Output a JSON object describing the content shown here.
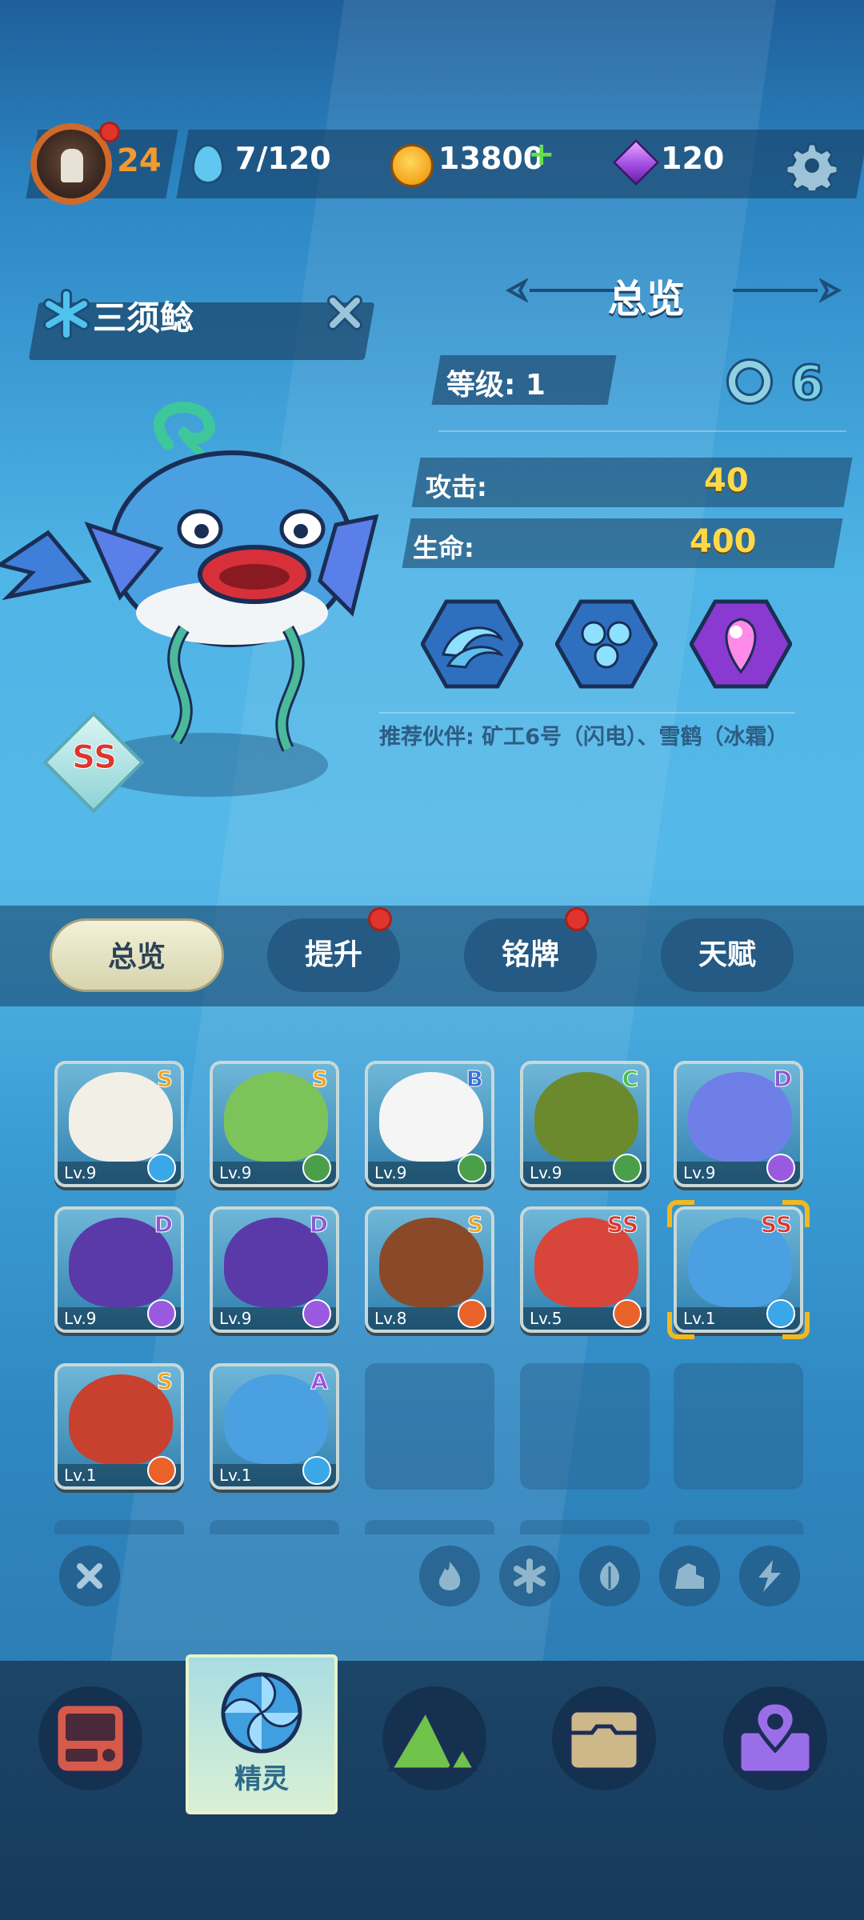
{
  "topbar": {
    "player_level": "24",
    "energy": "7/120",
    "coins": "13800",
    "plus_label": "+",
    "gems": "120"
  },
  "pet": {
    "name": "三须鲶",
    "rank": "SS"
  },
  "overview": {
    "title": "总览",
    "level_label": "等级: 1",
    "level_icon_text": "6",
    "attack_label": "攻击:",
    "attack_value": "40",
    "hp_label": "生命:",
    "hp_value": "400",
    "recommend_text": "推荐伙伴: 矿工6号（闪电）、雪鹤（冰霜）"
  },
  "tabs": [
    {
      "label": "总览",
      "active": true
    },
    {
      "label": "提升",
      "active": false
    },
    {
      "label": "铭牌",
      "active": false
    },
    {
      "label": "天赋",
      "active": false
    }
  ],
  "pets_grid": [
    {
      "grade": "S",
      "level": "Lv.9",
      "element": "snowflake",
      "grade_color": "#f3a21e",
      "body": "#f2efe6"
    },
    {
      "grade": "S",
      "level": "Lv.9",
      "element": "leaf",
      "grade_color": "#f3a21e",
      "body": "#7cc35a"
    },
    {
      "grade": "B",
      "level": "Lv.9",
      "element": "leaf",
      "grade_color": "#3c6ed8",
      "body": "#f5f5f5"
    },
    {
      "grade": "C",
      "level": "Lv.9",
      "element": "leaf",
      "grade_color": "#4bbf4b",
      "body": "#6b8a2e"
    },
    {
      "grade": "D",
      "level": "Lv.9",
      "element": "lightning",
      "grade_color": "#8a5ad0",
      "body": "#6f7fe8"
    },
    {
      "grade": "D",
      "level": "Lv.9",
      "element": "lightning",
      "grade_color": "#8a5ad0",
      "body": "#5a3aa8"
    },
    {
      "grade": "D",
      "level": "Lv.9",
      "element": "lightning",
      "grade_color": "#8a5ad0",
      "body": "#5a3aa8"
    },
    {
      "grade": "S",
      "level": "Lv.8",
      "element": "fire",
      "grade_color": "#f3a21e",
      "body": "#8a4a2a"
    },
    {
      "grade": "SS",
      "level": "Lv.5",
      "element": "fire",
      "grade_color": "#e0342c",
      "body": "#d8453a"
    },
    {
      "grade": "SS",
      "level": "Lv.1",
      "element": "snowflake",
      "grade_color": "#e0342c",
      "body": "#4aa0e0",
      "selected": true
    },
    {
      "grade": "S",
      "level": "Lv.1",
      "element": "fire",
      "grade_color": "#f3a21e",
      "body": "#c8402e"
    },
    {
      "grade": "A",
      "level": "Lv.1",
      "element": "snowflake",
      "grade_color": "#a24ee3",
      "body": "#4aa0e0"
    }
  ],
  "bottom_nav": {
    "active_label": "精灵"
  },
  "colors": {
    "fire": "#e8622a",
    "leaf": "#4aa04a",
    "snowflake": "#3aa8e8",
    "lightning": "#9a5ae0"
  }
}
